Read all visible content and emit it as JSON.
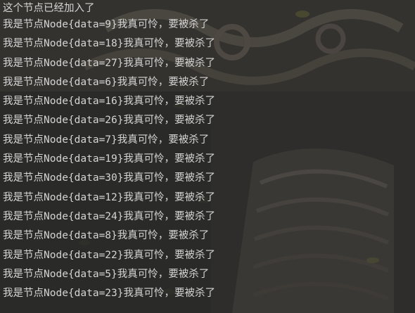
{
  "console": {
    "lines": [
      "这个节点已经加入了",
      "我是节点Node{data=9}我真可怜，要被杀了",
      "我是节点Node{data=18}我真可怜，要被杀了",
      "我是节点Node{data=27}我真可怜，要被杀了",
      "我是节点Node{data=6}我真可怜，要被杀了",
      "我是节点Node{data=16}我真可怜，要被杀了",
      "我是节点Node{data=26}我真可怜，要被杀了",
      "我是节点Node{data=7}我真可怜，要被杀了",
      "我是节点Node{data=19}我真可怜，要被杀了",
      "我是节点Node{data=30}我真可怜，要被杀了",
      "我是节点Node{data=12}我真可怜，要被杀了",
      "我是节点Node{data=24}我真可怜，要被杀了",
      "我是节点Node{data=8}我真可怜，要被杀了",
      "我是节点Node{data=22}我真可怜，要被杀了",
      "我是节点Node{data=5}我真可怜，要被杀了",
      "我是节点Node{data=23}我真可怜，要被杀了"
    ]
  },
  "colors": {
    "background": "#2b2b2b",
    "text": "#d4d4d4"
  }
}
